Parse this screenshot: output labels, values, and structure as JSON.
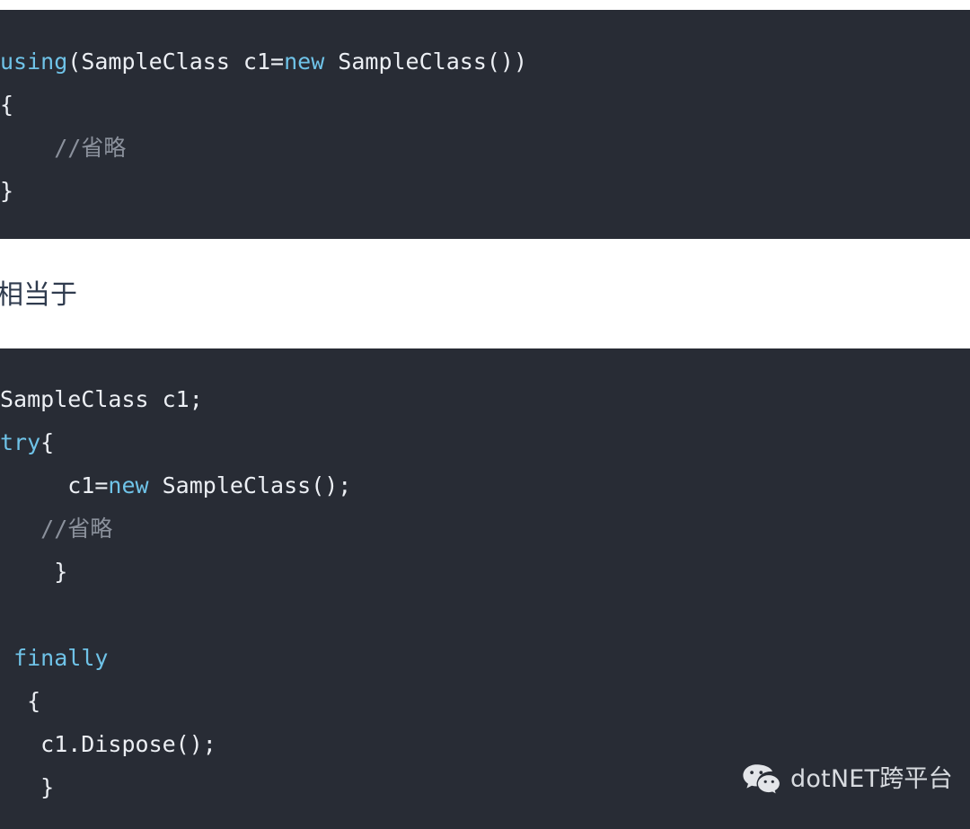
{
  "theme": {
    "code_background": "#282c35",
    "page_background": "#ffffff",
    "code_foreground": "#eceff4",
    "keyword_color": "#6fc3e8",
    "comment_color": "#8b919c",
    "prose_color": "#2f3b4e",
    "watermark_color": "#e6e9ee"
  },
  "code_block_1": {
    "language": "csharp",
    "lines": [
      [
        {
          "text": "using",
          "type": "keyword"
        },
        {
          "text": "(SampleClass c1=",
          "type": "plain"
        },
        {
          "text": "new",
          "type": "keyword"
        },
        {
          "text": " SampleClass())",
          "type": "plain"
        }
      ],
      [
        {
          "text": "{",
          "type": "plain"
        }
      ],
      [
        {
          "text": "    //省略",
          "type": "comment"
        }
      ],
      [
        {
          "text": "}",
          "type": "plain"
        }
      ]
    ]
  },
  "prose": {
    "text": "相当于"
  },
  "code_block_2": {
    "language": "csharp",
    "lines": [
      [
        {
          "text": "SampleClass c1;",
          "type": "plain"
        }
      ],
      [
        {
          "text": "try",
          "type": "keyword"
        },
        {
          "text": "{",
          "type": "plain"
        }
      ],
      [
        {
          "text": "     c1=",
          "type": "plain"
        },
        {
          "text": "new",
          "type": "keyword"
        },
        {
          "text": " SampleClass();",
          "type": "plain"
        }
      ],
      [
        {
          "text": "   //省略",
          "type": "comment"
        }
      ],
      [
        {
          "text": "    }",
          "type": "plain"
        }
      ],
      [
        {
          "text": "",
          "type": "plain"
        }
      ],
      [
        {
          "text": " ",
          "type": "plain"
        },
        {
          "text": "finally",
          "type": "keyword"
        }
      ],
      [
        {
          "text": "  {",
          "type": "plain"
        }
      ],
      [
        {
          "text": "   c1.Dispose();",
          "type": "plain"
        }
      ],
      [
        {
          "text": "   }",
          "type": "plain"
        }
      ]
    ]
  },
  "watermark": {
    "icon": "wechat-icon",
    "label": "dotNET跨平台"
  }
}
